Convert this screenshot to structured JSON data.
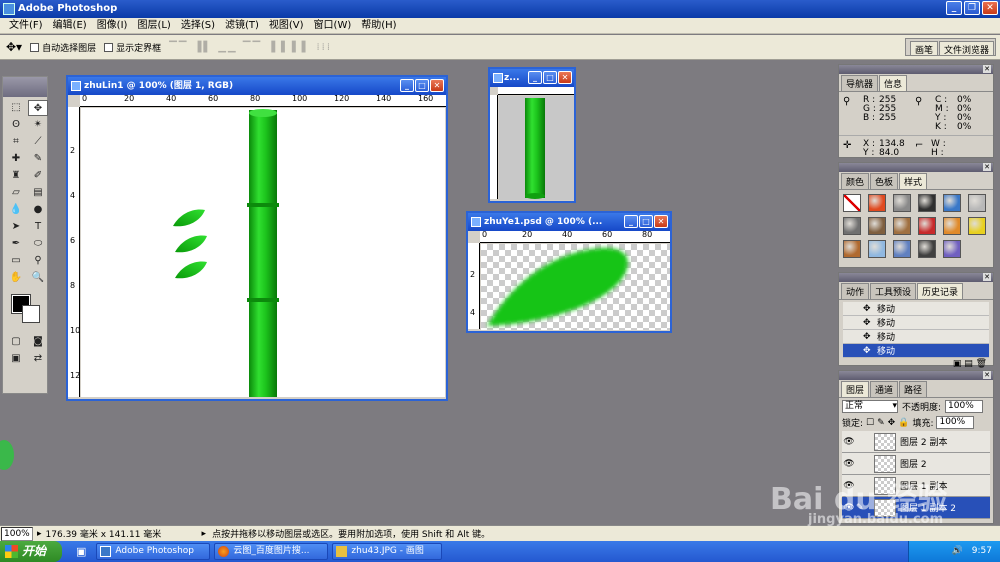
{
  "app": {
    "title": "Adobe Photoshop"
  },
  "menu": [
    "文件(F)",
    "编辑(E)",
    "图像(I)",
    "图层(L)",
    "选择(S)",
    "滤镜(T)",
    "视图(V)",
    "窗口(W)",
    "帮助(H)"
  ],
  "options": {
    "auto_select": "自动选择图层",
    "show_bounds": "显示定界框",
    "palette_tabs": [
      "画笔",
      "文件浏览器"
    ]
  },
  "doc_main": {
    "title": "zhuLin1 @ 100% (图层 1, RGB)",
    "ruler_h": [
      "0",
      "20",
      "40",
      "60",
      "80",
      "100",
      "120",
      "140",
      "160"
    ],
    "ruler_v": [
      "2",
      "4",
      "6",
      "8",
      "10",
      "12"
    ]
  },
  "doc_small": {
    "title": "z..."
  },
  "doc_leaf": {
    "title": "zhuYe1.psd @ 100% (...",
    "ruler_h": [
      "0",
      "20",
      "40",
      "60",
      "80"
    ],
    "ruler_v": [
      "2",
      "4"
    ]
  },
  "info_panel": {
    "tabs": [
      "导航器",
      "信息"
    ],
    "r": "255",
    "g": "255",
    "b": "255",
    "c": "0%",
    "m": "0%",
    "y": "0%",
    "k": "0%",
    "x": "134.8",
    "yv": "84.0",
    "labels": {
      "r": "R :",
      "g": "G :",
      "b": "B :",
      "c": "C :",
      "m": "M :",
      "y": "Y :",
      "k": "K :",
      "x": "X :",
      "yy": "Y :",
      "w": "W :",
      "h": "H :"
    }
  },
  "swatch_panel": {
    "tabs": [
      "颜色",
      "色板",
      "样式"
    ],
    "colors": [
      "#ffffff",
      "#e04a20",
      "#8a8a8a",
      "#303030",
      "#3a78c8",
      "#b8b8b8",
      "#707070",
      "#806040",
      "#a07040",
      "#c82a2a",
      "#e08a2a",
      "#e8d020",
      "#b06a30",
      "#90b8e0",
      "#6080c0",
      "#404040",
      "#7060c0"
    ]
  },
  "history_panel": {
    "tabs": [
      "动作",
      "工具预设",
      "历史记录"
    ],
    "items": [
      "移动",
      "移动",
      "移动",
      "移动"
    ]
  },
  "layers_panel": {
    "tabs": [
      "图层",
      "通道",
      "路径"
    ],
    "blend_mode": "正常",
    "opacity_label": "不透明度:",
    "opacity": "100%",
    "lock_label": "锁定:",
    "fill_label": "填充:",
    "fill": "100%",
    "layers": [
      "图层 2 副本",
      "图层 2",
      "图层 1 副本",
      "图层 1 副本 2"
    ]
  },
  "status": {
    "zoom": "100%",
    "dimensions": "176.39 毫米 x 141.11 毫米",
    "hint": "点按并拖移以移动图层或选区。要用附加选项，使用 Shift 和 Alt 键。"
  },
  "taskbar": {
    "start": "开始",
    "tasks": [
      "Adobe Photoshop",
      "云图_百度图片搜...",
      "zhu43.JPG - 画图"
    ],
    "clock": "9:57"
  },
  "watermark": {
    "logo": "Bai du 经验",
    "url": "jingyan.baidu.com"
  },
  "colors": {
    "bamboo": "#1fc41f",
    "title_blue": "#1648c8",
    "selection": "#2850b8"
  }
}
